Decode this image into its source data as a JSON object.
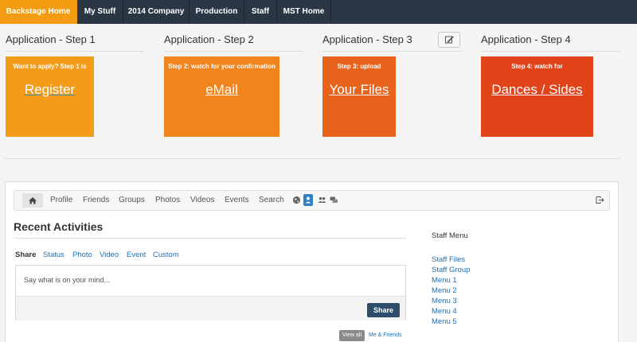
{
  "topnav": [
    {
      "label": "Backstage Home",
      "active": true
    },
    {
      "label": "My Stuff"
    },
    {
      "label": "2014 Company"
    },
    {
      "label": "Production"
    },
    {
      "label": "Staff"
    },
    {
      "label": "MST Home"
    }
  ],
  "steps": [
    {
      "heading": "Application - Step 1",
      "caption": "Want to apply?  Step 1 is",
      "link": "Register",
      "color": "#f39c1a"
    },
    {
      "heading": "Application - Step 2",
      "caption": "Step 2: watch for your confirmation",
      "link": "eMail",
      "color": "#f0841f"
    },
    {
      "heading": "Application - Step 3",
      "caption": "Step 3: upload",
      "link": "Your Files",
      "color": "#e8631b"
    },
    {
      "heading": "Application - Step 4",
      "caption": "Step 4: watch for",
      "link": "Dances / Sides",
      "color": "#e2441a"
    }
  ],
  "edit_icon": "pencil-square-icon",
  "activity_toolbar": {
    "home_icon": "home-icon",
    "items": [
      "Profile",
      "Friends",
      "Groups",
      "Photos",
      "Videos",
      "Events",
      "Search"
    ],
    "icons": [
      "globe-icon",
      "user-badge-icon",
      "users-icon",
      "chat-icon"
    ],
    "right_icon": "logout-icon"
  },
  "activities": {
    "title": "Recent Activities",
    "share_label": "Share",
    "share_tabs": [
      "Status",
      "Photo",
      "Video",
      "Event",
      "Custom"
    ],
    "placeholder": "Say what is on your mind...",
    "share_button": "Share",
    "view_all": "View all",
    "me_friends": "Me & Friends"
  },
  "staff_menu": {
    "title": "Staff Menu",
    "items": [
      "Staff Files",
      "Staff Group",
      "Menu 1",
      "Menu 2",
      "Menu 3",
      "Menu 4",
      "Menu 5"
    ]
  },
  "colors": {
    "nav_bg": "#2a3644",
    "nav_active": "#f39c12",
    "link": "#1e6fb5",
    "share_button": "#2e4c6b"
  }
}
